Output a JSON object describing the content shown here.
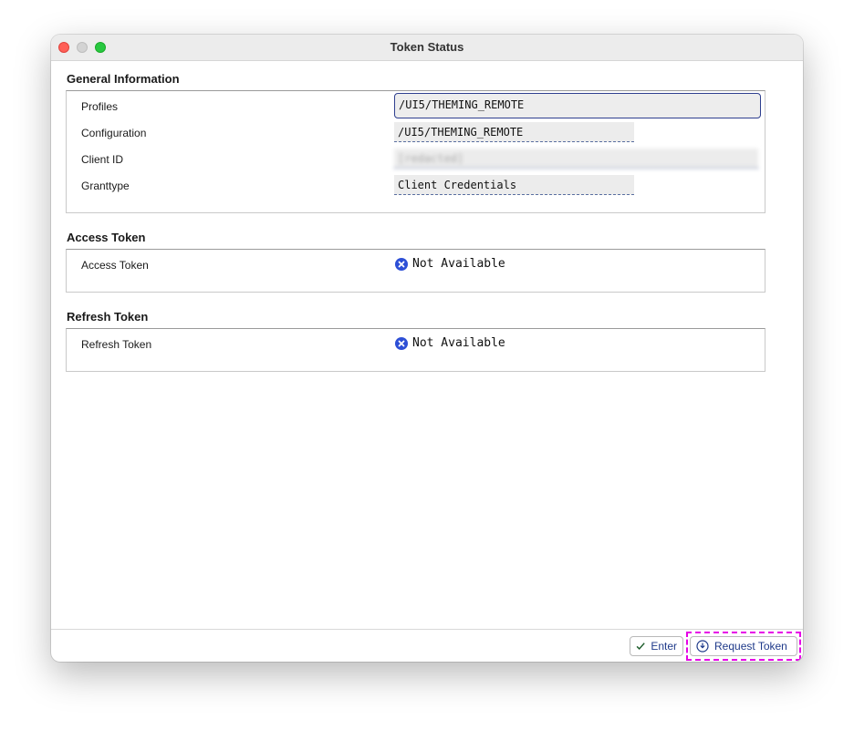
{
  "window": {
    "title": "Token Status"
  },
  "general": {
    "section_title": "General Information",
    "profiles_label": "Profiles",
    "profiles_value": "/UI5/THEMING_REMOTE",
    "configuration_label": "Configuration",
    "configuration_value": "/UI5/THEMING_REMOTE",
    "client_id_label": "Client ID",
    "client_id_value": "[redacted]",
    "granttype_label": "Granttype",
    "granttype_value": "Client Credentials"
  },
  "access": {
    "section_title": "Access Token",
    "label": "Access Token",
    "status": "Not Available"
  },
  "refresh": {
    "section_title": "Refresh Token",
    "label": "Refresh Token",
    "status": "Not Available"
  },
  "footer": {
    "enter_label": "Enter",
    "request_token_label": "Request Token"
  },
  "icons": {
    "status_icon": "x-circle-icon",
    "enter_icon": "checkmark-icon",
    "request_icon": "request-token-icon"
  },
  "colors": {
    "accent": "#1f3a8a",
    "status_icon": "#2d4fd6",
    "highlight": "#e600e6",
    "close": "#ff5f57",
    "minimize": "#d3d3d3",
    "maximize": "#28c840"
  }
}
